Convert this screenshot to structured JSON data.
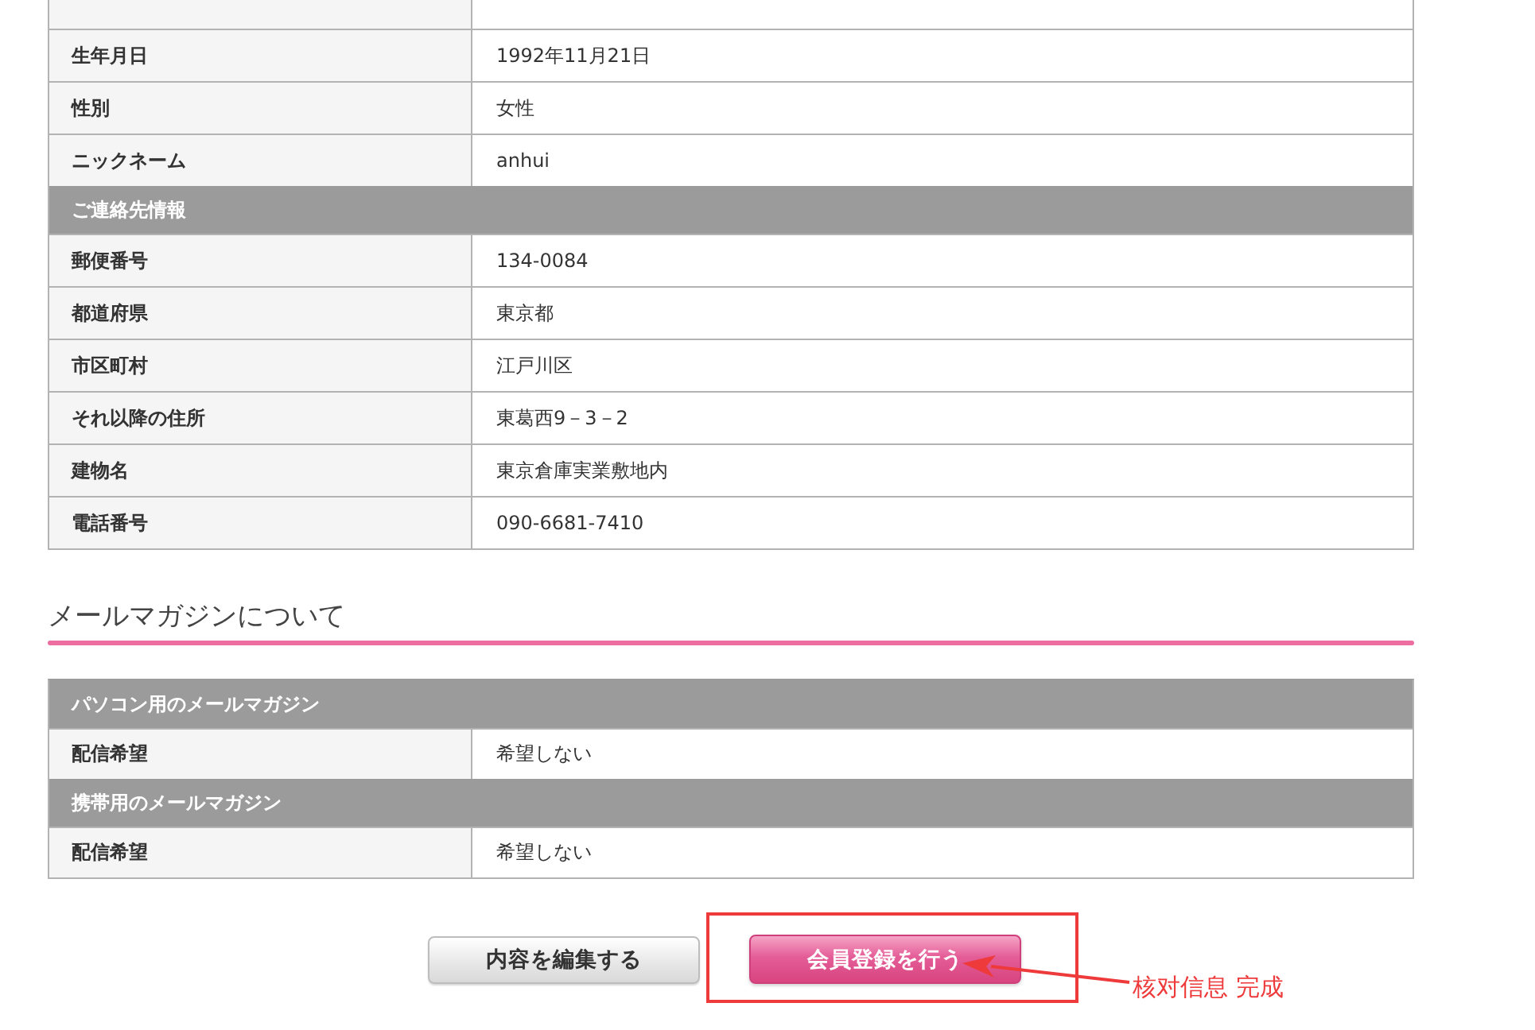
{
  "profile_table": {
    "rows": [
      {
        "kind": "field",
        "label": "生年月日",
        "value": "1992年11月21日"
      },
      {
        "kind": "field",
        "label": "性別",
        "value": "女性"
      },
      {
        "kind": "field",
        "label": "ニックネーム",
        "value": "anhui"
      },
      {
        "kind": "group",
        "title": "ご連絡先情報"
      },
      {
        "kind": "field",
        "label": "郵便番号",
        "value": "134-0084"
      },
      {
        "kind": "field",
        "label": "都道府県",
        "value": "東京都"
      },
      {
        "kind": "field",
        "label": "市区町村",
        "value": "江戸川区"
      },
      {
        "kind": "field",
        "label": "それ以降の住所",
        "value": "東葛西9－3－2"
      },
      {
        "kind": "field",
        "label": "建物名",
        "value": "東京倉庫実業敷地内"
      },
      {
        "kind": "field",
        "label": "電話番号",
        "value": "090-6681-7410"
      }
    ]
  },
  "mail_magazine": {
    "heading": "メールマガジンについて",
    "rows": [
      {
        "kind": "group",
        "title": "パソコン用のメールマガジン"
      },
      {
        "kind": "field",
        "label": "配信希望",
        "value": "希望しない"
      },
      {
        "kind": "group",
        "title": "携帯用のメールマガジン"
      },
      {
        "kind": "field",
        "label": "配信希望",
        "value": "希望しない"
      }
    ]
  },
  "buttons": [
    {
      "kind": "secondary",
      "label": "内容を編集する"
    },
    {
      "kind": "primary",
      "label": "会員登録を行う"
    }
  ],
  "annotation": {
    "text": "核对信息 完成"
  }
}
